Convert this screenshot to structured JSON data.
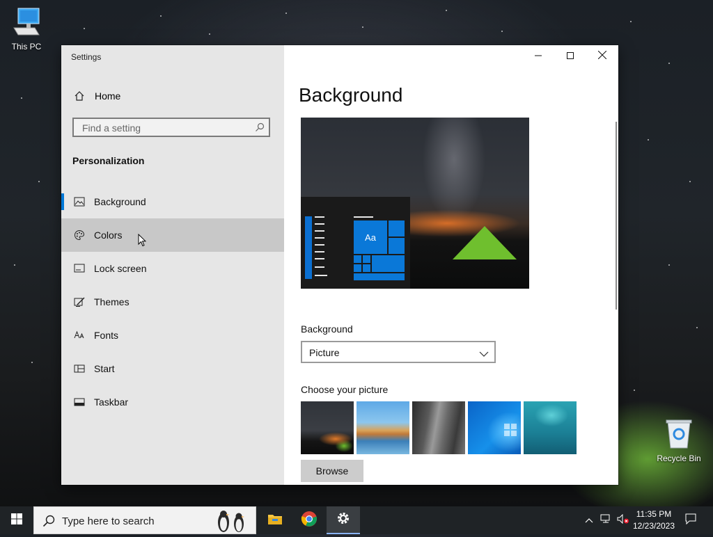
{
  "desktop": {
    "icons": [
      {
        "label": "This PC",
        "icon": "computer-icon"
      },
      {
        "label": "Recycle Bin",
        "icon": "recycle-bin-icon"
      }
    ]
  },
  "window": {
    "title": "Settings",
    "controls": {
      "minimize": "minimize-icon",
      "maximize": "maximize-icon",
      "close": "close-icon"
    }
  },
  "sidebar": {
    "home_label": "Home",
    "search_placeholder": "Find a setting",
    "section_title": "Personalization",
    "items": [
      {
        "label": "Background",
        "icon": "picture-icon",
        "selected": true
      },
      {
        "label": "Colors",
        "icon": "palette-icon",
        "hovered": true
      },
      {
        "label": "Lock screen",
        "icon": "lock-screen-icon"
      },
      {
        "label": "Themes",
        "icon": "brush-icon"
      },
      {
        "label": "Fonts",
        "icon": "font-icon"
      },
      {
        "label": "Start",
        "icon": "start-icon"
      },
      {
        "label": "Taskbar",
        "icon": "taskbar-icon"
      }
    ]
  },
  "main": {
    "title": "Background",
    "preview_tile_text": "Aa",
    "background_label": "Background",
    "background_value": "Picture",
    "choose_label": "Choose your picture",
    "thumbnails": [
      "night-sky-tent",
      "beach-rocks",
      "rock-cliff",
      "windows-blue",
      "underwater-swimmer"
    ],
    "browse_label": "Browse"
  },
  "taskbar": {
    "search_placeholder": "Type here to search",
    "apps": [
      "file-explorer-icon",
      "chrome-icon",
      "settings-gear-icon"
    ],
    "time": "11:35 PM",
    "date": "12/23/2023"
  },
  "colors": {
    "accent": "#0078d7",
    "sidebar_bg": "#e6e6e6",
    "hover_bg": "#c8c8c8",
    "taskbar_bg": "#1f2326"
  }
}
